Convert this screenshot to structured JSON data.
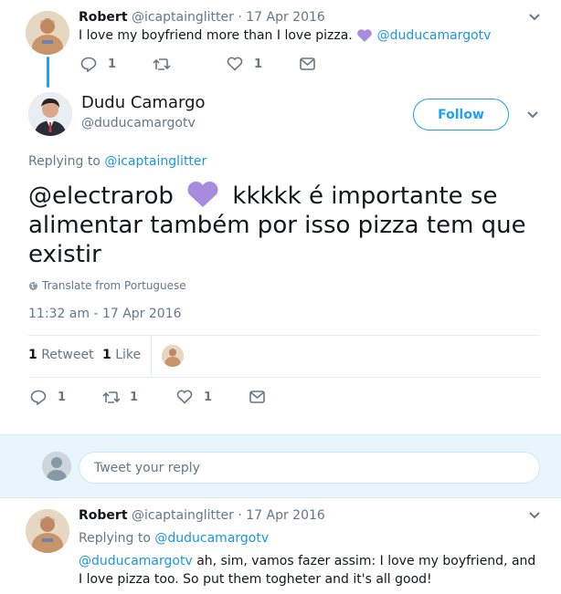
{
  "tweet1": {
    "name": "Robert",
    "handle": "@icaptainglitter",
    "date": "· 17 Apr 2016",
    "text": "I love my boyfriend more than I love pizza.",
    "mention": "@duducamargotv",
    "reply_count": "1",
    "like_count": "1"
  },
  "main": {
    "name": "Dudu Camargo",
    "handle": "@duducamargotv",
    "follow_label": "Follow",
    "replying_prefix": "Replying to",
    "replying_handle": "@icaptainglitter",
    "text_mention": "@electrarob",
    "text_body": "kkkkk é importante se alimentar também por isso pizza tem que existir",
    "translate_label": "Translate from Portuguese",
    "timestamp": "11:32 am - 17 Apr 2016",
    "retweets_num": "1",
    "retweets_label": "Retweet",
    "likes_num": "1",
    "likes_label": "Like",
    "reply_count": "1",
    "retweet_count": "1",
    "like_count": "1"
  },
  "reply_box": {
    "placeholder": "Tweet your reply"
  },
  "tweet3": {
    "name": "Robert",
    "handle": "@icaptainglitter",
    "date": "· 17 Apr 2016",
    "replying_prefix": "Replying to",
    "replying_handle": "@duducamargotv",
    "mention": "@duducamargotv",
    "text_line1": "ah, sim, vamos fazer assim: I love my boyfriend, and",
    "text_line2": "I love pizza too. So put them togheter and it's all good!"
  },
  "colors": {
    "accent": "#1da1f2",
    "link": "#1b95e0",
    "muted": "#657786",
    "heart_emoji": "#a78bdc",
    "reply_bar": "#e8f5fd"
  }
}
